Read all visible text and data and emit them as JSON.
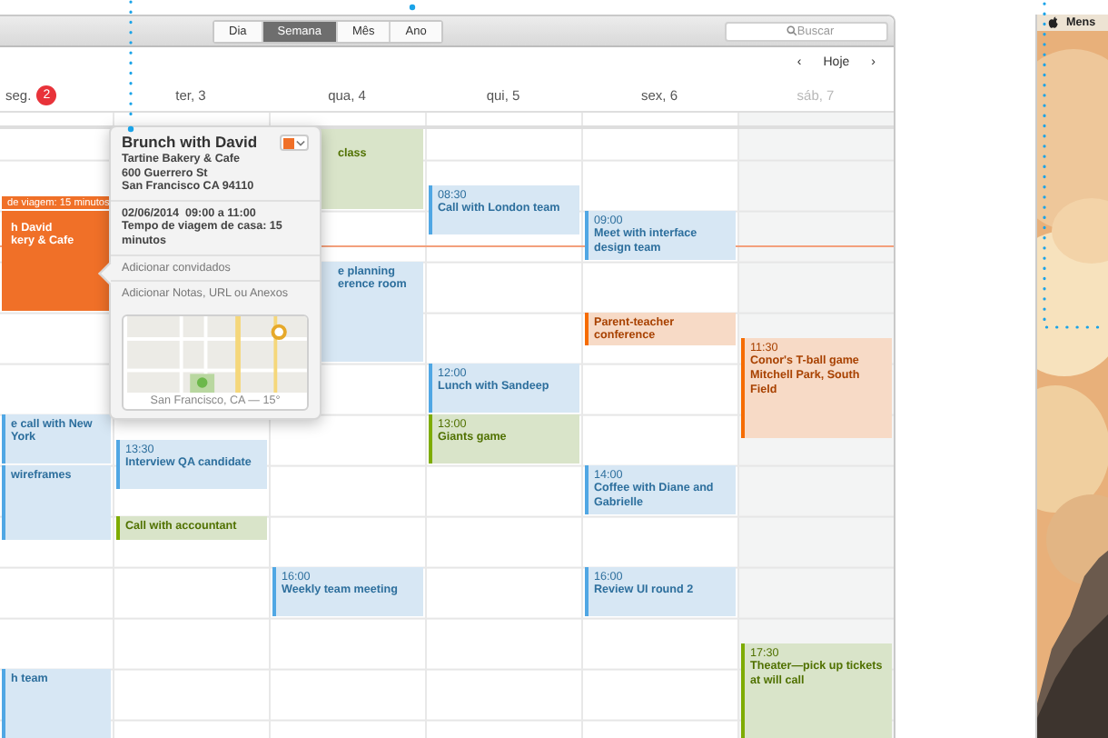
{
  "toolbar": {
    "views": [
      {
        "label": "Dia",
        "selected": false
      },
      {
        "label": "Semana",
        "selected": true
      },
      {
        "label": "Mês",
        "selected": false
      },
      {
        "label": "Ano",
        "selected": false
      }
    ],
    "search": {
      "placeholder": "Buscar"
    }
  },
  "nav": {
    "prev": "‹",
    "today": "Hoje",
    "next": "›"
  },
  "days": [
    {
      "label": "seg.",
      "badge": "2",
      "weekend": false,
      "events": [
        {
          "title": "h David",
          "subtitle": "kery & Cafe",
          "travel": "de viagem: 15 minutos",
          "color": "#f07028",
          "selected": true
        },
        {
          "title": "e call with New York",
          "color": "#d7e7f4",
          "selected": false
        },
        {
          "title": "wireframes",
          "color": "#d7e7f4",
          "selected": false
        },
        {
          "title": "h team",
          "color": "#d7e7f4",
          "selected": false
        }
      ]
    },
    {
      "label": "ter, 3",
      "weekend": false,
      "events": [
        {
          "time": "13:30",
          "title": "Interview QA candidate",
          "color": "#d7e7f4",
          "selected": false
        },
        {
          "title": "Call with accountant",
          "color": "#d9e4c9",
          "selected": false
        }
      ]
    },
    {
      "label": "qua, 4",
      "weekend": false,
      "events": [
        {
          "title": "class",
          "color": "#d9e4c9",
          "selected": false
        },
        {
          "title": "e planning",
          "subtitle": "erence room",
          "color": "#d7e7f4",
          "selected": false
        },
        {
          "time": "16:00",
          "title": "Weekly team meeting",
          "color": "#d7e7f4",
          "selected": false
        }
      ]
    },
    {
      "label": "qui, 5",
      "weekend": false,
      "events": [
        {
          "time": "08:30",
          "title": "Call with London team",
          "color": "#d7e7f4",
          "selected": false
        },
        {
          "time": "12:00",
          "title": "Lunch with Sandeep",
          "color": "#d7e7f4",
          "selected": false
        },
        {
          "time": "13:00",
          "title": "Giants game",
          "color": "#d9e4c9",
          "selected": false
        }
      ]
    },
    {
      "label": "sex, 6",
      "weekend": false,
      "events": [
        {
          "time": "09:00",
          "title": "Meet with interface design team",
          "color": "#d7e7f4",
          "selected": false
        },
        {
          "title": "Parent-teacher conference",
          "color": "#f7dac6",
          "selected": false
        },
        {
          "time": "14:00",
          "title": "Coffee with Diane and Gabrielle",
          "color": "#d7e7f4",
          "selected": false
        },
        {
          "time": "16:00",
          "title": "Review UI round 2",
          "color": "#d7e7f4",
          "selected": false
        }
      ]
    },
    {
      "label": "sáb, 7",
      "weekend": true,
      "events": [
        {
          "time": "11:30",
          "title": "Conor's T-ball game",
          "subtitle": "Mitchell Park, South Field",
          "color": "#f7dac6",
          "selected": false
        },
        {
          "time": "17:30",
          "title": "Theater—pick up tickets at will call",
          "color": "#d9e4c9",
          "selected": false
        }
      ]
    }
  ],
  "popover": {
    "title": "Brunch with David",
    "address": [
      "Tartine Bakery & Cafe",
      "600 Guerrero St",
      "San Francisco CA 94110"
    ],
    "color": "#f07028",
    "date": "02/06/2014  09:00 a 11:00",
    "travel": "Tempo de viagem de casa: 15 minutos",
    "invitees": "Adicionar convidados",
    "notes": "Adicionar Notas, URL ou Anexos",
    "map_caption": "San Francisco, CA — 15°"
  },
  "desktop": {
    "menu": "Mens"
  }
}
